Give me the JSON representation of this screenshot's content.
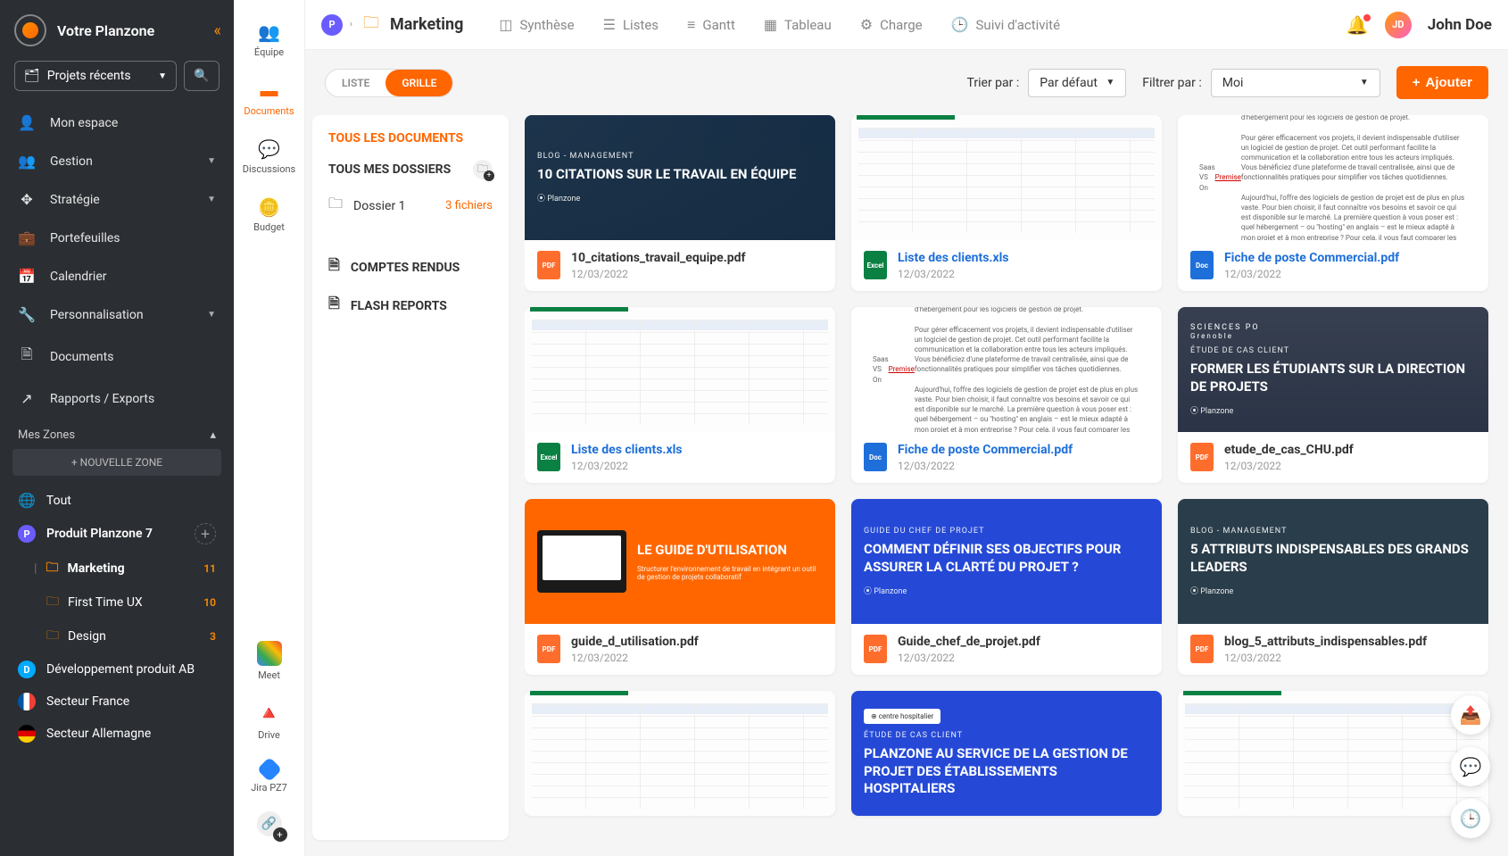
{
  "sidebar": {
    "title": "Votre Planzone",
    "recent": "Projets récents",
    "nav": [
      {
        "icon": "user",
        "label": "Mon espace",
        "chev": false
      },
      {
        "icon": "users",
        "label": "Gestion",
        "chev": true
      },
      {
        "icon": "strategy",
        "label": "Stratégie",
        "chev": true
      },
      {
        "icon": "portfolio",
        "label": "Portefeuilles",
        "chev": false
      },
      {
        "icon": "calendar",
        "label": "Calendrier",
        "chev": false
      },
      {
        "icon": "wrench",
        "label": "Personnalisation",
        "chev": true
      },
      {
        "icon": "docs",
        "label": "Documents",
        "chev": false
      },
      {
        "icon": "export",
        "label": "Rapports / Exports",
        "chev": false
      }
    ],
    "zones_label": "Mes Zones",
    "new_zone": "+ NOUVELLE ZONE",
    "zones": {
      "all": "Tout",
      "product": "Produit Planzone 7",
      "marketing": "Marketing",
      "marketing_count": "11",
      "firstux": "First Time UX",
      "firstux_count": "10",
      "design": "Design",
      "design_count": "3",
      "dev": "Développement produit AB",
      "france": "Secteur France",
      "germany": "Secteur Allemagne"
    }
  },
  "rail": {
    "equipe": "Équipe",
    "documents": "Documents",
    "discussions": "Discussions",
    "budget": "Budget",
    "meet": "Meet",
    "drive": "Drive",
    "jira": "Jira PZ7"
  },
  "topbar": {
    "proj_initial": "P",
    "proj_name": "Marketing",
    "tabs": [
      {
        "icon": "grid",
        "label": "Synthèse"
      },
      {
        "icon": "list",
        "label": "Listes"
      },
      {
        "icon": "gantt",
        "label": "Gantt"
      },
      {
        "icon": "table",
        "label": "Tableau"
      },
      {
        "icon": "load",
        "label": "Charge"
      },
      {
        "icon": "activity",
        "label": "Suivi d'activité"
      }
    ],
    "user_initials": "JD",
    "user_name": "John Doe"
  },
  "toolbar": {
    "view_list": "LISTE",
    "view_grid": "GRILLE",
    "sort_label": "Trier par :",
    "sort_value": "Par défaut",
    "filter_label": "Filtrer par :",
    "filter_value": "Moi",
    "add": "Ajouter"
  },
  "foldersPanel": {
    "all": "TOUS LES DOCUMENTS",
    "my": "TOUS MES DOSSIERS",
    "dossier1": "Dossier 1",
    "dossier1_count": "3 fichiers",
    "comptes": "COMPTES RENDUS",
    "flash": "FLASH REPORTS"
  },
  "thumbs": {
    "blog_tag": "BLOG - MANAGEMENT",
    "citations_title": "10 CITATIONS SUR LE TRAVAIL EN ÉQUIPE",
    "etude_tag": "ÉTUDE DE CAS CLIENT",
    "former_title": "FORMER LES ÉTUDIANTS SUR LA DIRECTION DE PROJETS",
    "guide_title": "LE GUIDE D'UTILISATION",
    "guide_sub": "Structurer l'environnement de travail en intégrant un outil de gestion de projets collaboratif",
    "chef_tag": "GUIDE DU CHEF DE PROJET",
    "chef_title": "COMMENT DÉFINIR SES OBJECTIFS POUR ASSURER LA CLARTÉ DU PROJET ?",
    "attrib_title": "5 ATTRIBUTS INDISPENSABLES DES GRANDS LEADERS",
    "hosp_title": "PLANZONE AU SERVICE DE LA GESTION DE PROJET DES ÉTABLISSEMENTS HOSPITALIERS",
    "brand": "⦿ Planzone"
  },
  "files": [
    {
      "type": "pdf",
      "name": "10_citations_travail_equipe.pdf",
      "date": "12/03/2022",
      "thumb": "citations",
      "link": false
    },
    {
      "type": "xls",
      "name": "Liste des clients.xls",
      "date": "12/03/2022",
      "thumb": "sheet",
      "link": true
    },
    {
      "type": "doc",
      "name": "Fiche de poste Commercial.pdf",
      "date": "12/03/2022",
      "thumb": "text",
      "link": true
    },
    {
      "type": "xls",
      "name": "Liste des clients.xls",
      "date": "12/03/2022",
      "thumb": "sheet",
      "link": true
    },
    {
      "type": "doc",
      "name": "Fiche de poste Commercial.pdf",
      "date": "12/03/2022",
      "thumb": "text",
      "link": true
    },
    {
      "type": "pdf",
      "name": "etude_de_cas_CHU.pdf",
      "date": "12/03/2022",
      "thumb": "former",
      "link": false
    },
    {
      "type": "pdf",
      "name": "guide_d_utilisation.pdf",
      "date": "12/03/2022",
      "thumb": "guide",
      "link": false
    },
    {
      "type": "pdf",
      "name": "Guide_chef_de_projet.pdf",
      "date": "12/03/2022",
      "thumb": "chef",
      "link": false
    },
    {
      "type": "pdf",
      "name": "blog_5_attributs_indispensables.pdf",
      "date": "12/03/2022",
      "thumb": "attrib",
      "link": false
    },
    {
      "type": "xls",
      "name": "",
      "date": "",
      "thumb": "sheet",
      "link": false
    },
    {
      "type": "pdf",
      "name": "",
      "date": "",
      "thumb": "hosp",
      "link": false
    },
    {
      "type": "xls",
      "name": "",
      "date": "",
      "thumb": "sheet",
      "link": false
    }
  ]
}
